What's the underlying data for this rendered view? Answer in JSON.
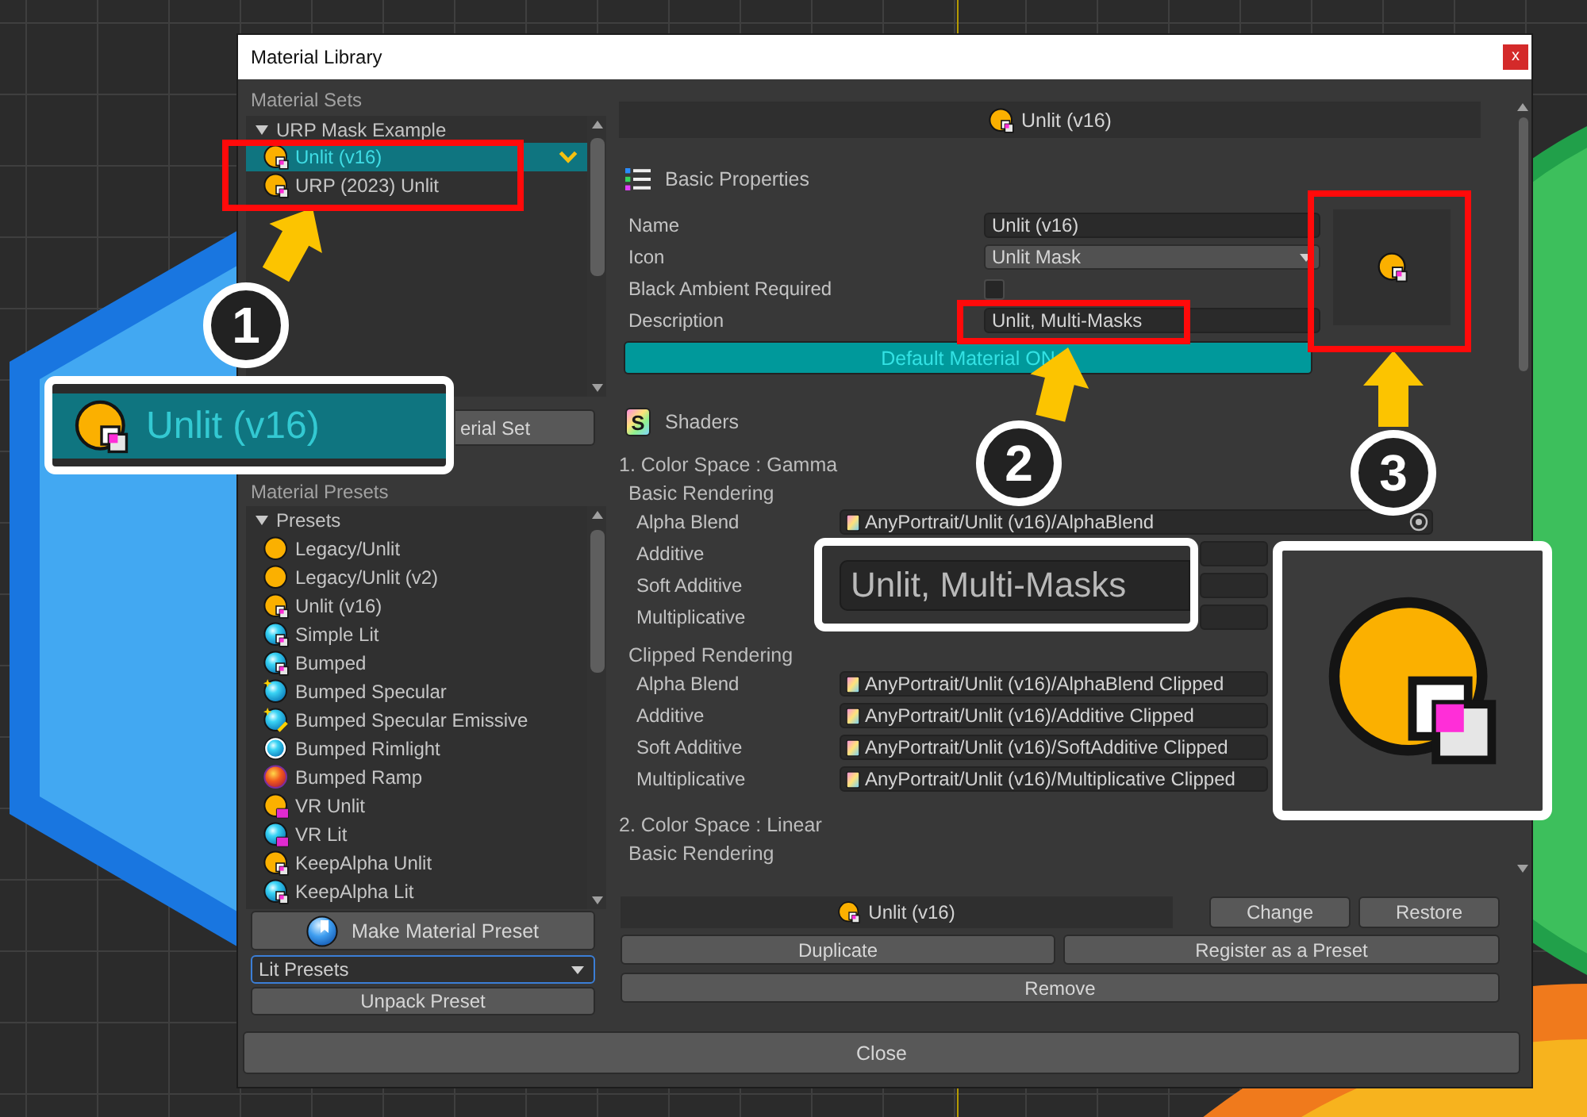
{
  "window": {
    "title": "Material Library",
    "close_label": "x"
  },
  "material_sets": {
    "label": "Material Sets",
    "tree": [
      {
        "label": "URP Mask Example",
        "expanded": true,
        "children": [
          {
            "label": "Unlit (v16)",
            "kind": "unlitmask",
            "selected": true
          },
          {
            "label": "URP (2023) Unlit",
            "kind": "unlitmask",
            "selected": false
          }
        ]
      }
    ],
    "button": "erial Set"
  },
  "material_presets": {
    "label": "Material Presets",
    "tree": [
      {
        "label": "Presets",
        "expanded": true,
        "children": [
          {
            "label": "Legacy/Unlit",
            "kind": "unlit",
            "selected": false
          },
          {
            "label": "Legacy/Unlit (v2)",
            "kind": "unlit",
            "selected": false
          },
          {
            "label": "Unlit (v16)",
            "kind": "unlitmask",
            "selected": false
          },
          {
            "label": "Simple Lit",
            "kind": "litmask",
            "selected": false
          },
          {
            "label": "Bumped",
            "kind": "litmask",
            "selected": false
          },
          {
            "label": "Bumped Specular",
            "kind": "specular",
            "selected": false
          },
          {
            "label": "Bumped Specular Emissive",
            "kind": "emissive",
            "selected": false
          },
          {
            "label": "Bumped Rimlight",
            "kind": "rimlight",
            "selected": false
          },
          {
            "label": "Bumped Ramp",
            "kind": "ramp",
            "selected": false
          },
          {
            "label": "VR Unlit",
            "kind": "vrunlit",
            "selected": false
          },
          {
            "label": "VR Lit",
            "kind": "vrlit",
            "selected": false
          },
          {
            "label": "KeepAlpha Unlit",
            "kind": "unlitmask",
            "selected": false
          },
          {
            "label": "KeepAlpha Lit",
            "kind": "litmask",
            "selected": false
          }
        ]
      }
    ],
    "make_button": "Make Material Preset",
    "preset_type": {
      "value": "Lit Presets"
    },
    "unpack_button": "Unpack Preset"
  },
  "detail": {
    "header": {
      "label": "Unlit (v16)",
      "kind": "unlitmask"
    },
    "basic_properties": {
      "title": "Basic Properties",
      "rows": [
        {
          "label": "Name",
          "kind": "text",
          "value": "Unlit (v16)"
        },
        {
          "label": "Icon",
          "kind": "dropdown",
          "value": "Unlit Mask"
        },
        {
          "label": "Black Ambient Required",
          "kind": "checkbox",
          "checked": false
        },
        {
          "label": "Description",
          "kind": "text",
          "value": "Unlit, Multi-Masks"
        }
      ],
      "preview": {
        "kind": "unlitmask"
      },
      "default_button": {
        "label": "Default Material ON",
        "on": true
      }
    },
    "shaders": {
      "title": "Shaders",
      "icon_letter": "S",
      "sections": [
        {
          "title": "1. Color Space : Gamma",
          "groups": [
            {
              "title": "Basic Rendering",
              "rows": [
                {
                  "label": "Alpha Blend",
                  "value": "AnyPortrait/Unlit (v16)/AlphaBlend",
                  "picker": true
                },
                {
                  "label": "Additive"
                },
                {
                  "label": "Soft Additive"
                },
                {
                  "label": "Multiplicative"
                }
              ]
            },
            {
              "title": "Clipped Rendering",
              "rows": [
                {
                  "label": "Alpha Blend",
                  "value": "AnyPortrait/Unlit (v16)/AlphaBlend Clipped"
                },
                {
                  "label": "Additive",
                  "value": "AnyPortrait/Unlit (v16)/Additive Clipped"
                },
                {
                  "label": "Soft Additive",
                  "value": "AnyPortrait/Unlit (v16)/SoftAdditive Clipped"
                },
                {
                  "label": "Multiplicative",
                  "value": "AnyPortrait/Unlit (v16)/Multiplicative Clipped"
                }
              ]
            }
          ]
        },
        {
          "title": "2. Color Space : Linear",
          "groups": [
            {
              "title": "Basic Rendering"
            }
          ]
        }
      ]
    }
  },
  "footer": {
    "current": {
      "label": "Unlit (v16)",
      "kind": "unlitmask"
    },
    "change_button": "Change",
    "restore_button": "Restore",
    "duplicate_button": "Duplicate",
    "register_button": "Register as a Preset",
    "remove_button": "Remove"
  },
  "close_button": "Close",
  "annotations": [
    {
      "number": "1",
      "callout": {
        "kind": "item",
        "label": "Unlit (v16)",
        "icon": {
          "kind": "unlitmask"
        }
      }
    },
    {
      "number": "2",
      "callout": {
        "kind": "field",
        "value": "Unlit, Multi-Masks"
      }
    },
    {
      "number": "3",
      "callout": {
        "kind": "icon",
        "icon": {
          "kind": "unlitmask"
        }
      }
    }
  ]
}
